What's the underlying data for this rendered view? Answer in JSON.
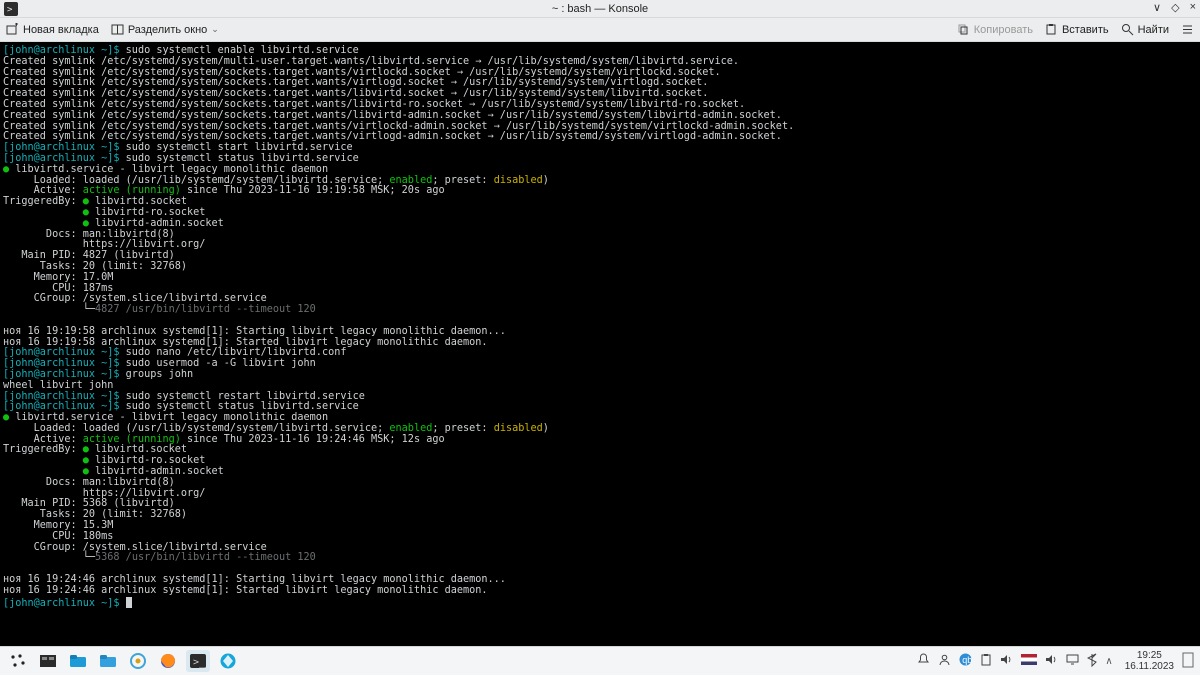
{
  "window": {
    "title": "~ : bash — Konsole",
    "close": "×",
    "maximize": "◇",
    "minimize": "∨"
  },
  "toolbar": {
    "new_tab": "Новая вкладка",
    "split": "Разделить окно",
    "copy": "Копировать",
    "paste": "Вставить",
    "find": "Найти"
  },
  "prompt": {
    "user": "[john@archlinux ~]$ "
  },
  "commands": {
    "enable": "sudo systemctl enable libvirtd.service",
    "start": "sudo systemctl start libvirtd.service",
    "status1": "sudo systemctl status libvirtd.service",
    "nano": "sudo nano /etc/libvirt/libvirtd.conf",
    "usermod": "sudo usermod -a -G libvirt john",
    "groups": "groups john",
    "restart": "sudo systemctl restart libvirtd.service",
    "status2": "sudo systemctl status libvirtd.service"
  },
  "enable_output": {
    "l1": "Created symlink /etc/systemd/system/multi-user.target.wants/libvirtd.service → /usr/lib/systemd/system/libvirtd.service.",
    "l2": "Created symlink /etc/systemd/system/sockets.target.wants/virtlockd.socket → /usr/lib/systemd/system/virtlockd.socket.",
    "l3": "Created symlink /etc/systemd/system/sockets.target.wants/virtlogd.socket → /usr/lib/systemd/system/virtlogd.socket.",
    "l4": "Created symlink /etc/systemd/system/sockets.target.wants/libvirtd.socket → /usr/lib/systemd/system/libvirtd.socket.",
    "l5": "Created symlink /etc/systemd/system/sockets.target.wants/libvirtd-ro.socket → /usr/lib/systemd/system/libvirtd-ro.socket.",
    "l6": "Created symlink /etc/systemd/system/sockets.target.wants/libvirtd-admin.socket → /usr/lib/systemd/system/libvirtd-admin.socket.",
    "l7": "Created symlink /etc/systemd/system/sockets.target.wants/virtlockd-admin.socket → /usr/lib/systemd/system/virtlockd-admin.socket.",
    "l8": "Created symlink /etc/systemd/system/sockets.target.wants/virtlogd-admin.socket → /usr/lib/systemd/system/virtlogd-admin.socket."
  },
  "status1": {
    "header": " libvirtd.service - libvirt legacy monolithic daemon",
    "loaded_pre": "     Loaded: loaded (/usr/lib/systemd/system/libvirtd.service; ",
    "enabled": "enabled",
    "preset_pre": "; preset: ",
    "disabled": "disabled",
    "paren": ")",
    "active_pre": "     Active: ",
    "active": "active (running)",
    "active_post": " since Thu 2023-11-16 19:19:58 MSK; 20s ago",
    "trig_pre": "TriggeredBy: ",
    "trig1": " libvirtd.socket",
    "trig2": " libvirtd-ro.socket",
    "trig3": " libvirtd-admin.socket",
    "docs1": "       Docs: man:libvirtd(8)",
    "docs2": "             https://libvirt.org/",
    "pid": "   Main PID: 4827 (libvirtd)",
    "tasks": "      Tasks: 20 (limit: 32768)",
    "mem": "     Memory: 17.0M",
    "cpu": "        CPU: 187ms",
    "cgrp": "     CGroup: /system.slice/libvirtd.service",
    "cgrp2_pre": "             └─",
    "cgrp2": "4827 /usr/bin/libvirtd --timeout 120",
    "log1": "ноя 16 19:19:58 archlinux systemd[1]: Starting libvirt legacy monolithic daemon...",
    "log2": "ноя 16 19:19:58 archlinux systemd[1]: Started libvirt legacy monolithic daemon."
  },
  "groups_out": "wheel libvirt john",
  "status2": {
    "header": " libvirtd.service - libvirt legacy monolithic daemon",
    "loaded_pre": "     Loaded: loaded (/usr/lib/systemd/system/libvirtd.service; ",
    "enabled": "enabled",
    "preset_pre": "; preset: ",
    "disabled": "disabled",
    "paren": ")",
    "active_pre": "     Active: ",
    "active": "active (running)",
    "active_post": " since Thu 2023-11-16 19:24:46 MSK; 12s ago",
    "trig_pre": "TriggeredBy: ",
    "trig1": " libvirtd.socket",
    "trig2": " libvirtd-ro.socket",
    "trig3": " libvirtd-admin.socket",
    "docs1": "       Docs: man:libvirtd(8)",
    "docs2": "             https://libvirt.org/",
    "pid": "   Main PID: 5368 (libvirtd)",
    "tasks": "      Tasks: 20 (limit: 32768)",
    "mem": "     Memory: 15.3M",
    "cpu": "        CPU: 180ms",
    "cgrp": "     CGroup: /system.slice/libvirtd.service",
    "cgrp2_pre": "             └─",
    "cgrp2": "5368 /usr/bin/libvirtd --timeout 120",
    "log1": "ноя 16 19:24:46 archlinux systemd[1]: Starting libvirt legacy monolithic daemon...",
    "log2": "ноя 16 19:24:46 archlinux systemd[1]: Started libvirt legacy monolithic daemon."
  },
  "padding": {
    "trig_pad": "             "
  },
  "taskbar": {
    "time": "19:25",
    "date": "16.11.2023"
  }
}
